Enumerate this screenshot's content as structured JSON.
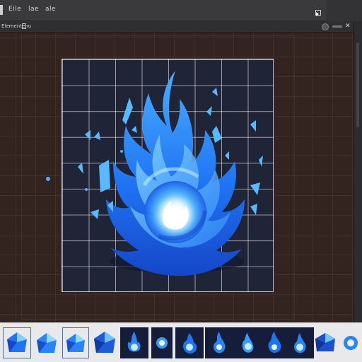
{
  "menubar": {
    "items": [
      "Eile",
      "lae",
      "ale"
    ],
    "controls": [
      "button",
      "close-icon",
      "menu-icon",
      "cursor-icon"
    ]
  },
  "toolbar": {
    "label": "Elementenu"
  },
  "colors": {
    "app_bg": "#34241f",
    "menubar": "#3a3a3c",
    "artboard_bg": "#1f2436",
    "flame_blue": "#1f6cf0",
    "flame_light": "#7fd0ff",
    "thumbstrip_bg": "#e9e9ec"
  },
  "artboard": {
    "content": "blue-flame-icon"
  },
  "thumbnails": [
    {
      "icon": "blue-crystal-icon",
      "selected": true
    },
    {
      "icon": "blue-crystal-icon",
      "selected": false
    },
    {
      "icon": "blue-crystal-icon",
      "selected": true
    },
    {
      "icon": "dark-crystal-icon",
      "selected": false
    },
    {
      "icon": "blue-flame-icon",
      "selected": false
    },
    {
      "icon": "glow-orb-icon",
      "selected": false
    },
    {
      "icon": "blue-flame-icon",
      "selected": false
    },
    {
      "icon": "blue-flame-icon",
      "selected": false
    },
    {
      "icon": "blue-flame-icon",
      "selected": false
    },
    {
      "icon": "blue-flame-icon",
      "selected": false
    },
    {
      "icon": "blue-flame-icon",
      "selected": false
    },
    {
      "icon": "blue-crystal-icon",
      "selected": false
    },
    {
      "icon": "glow-orb-icon",
      "selected": false
    }
  ]
}
